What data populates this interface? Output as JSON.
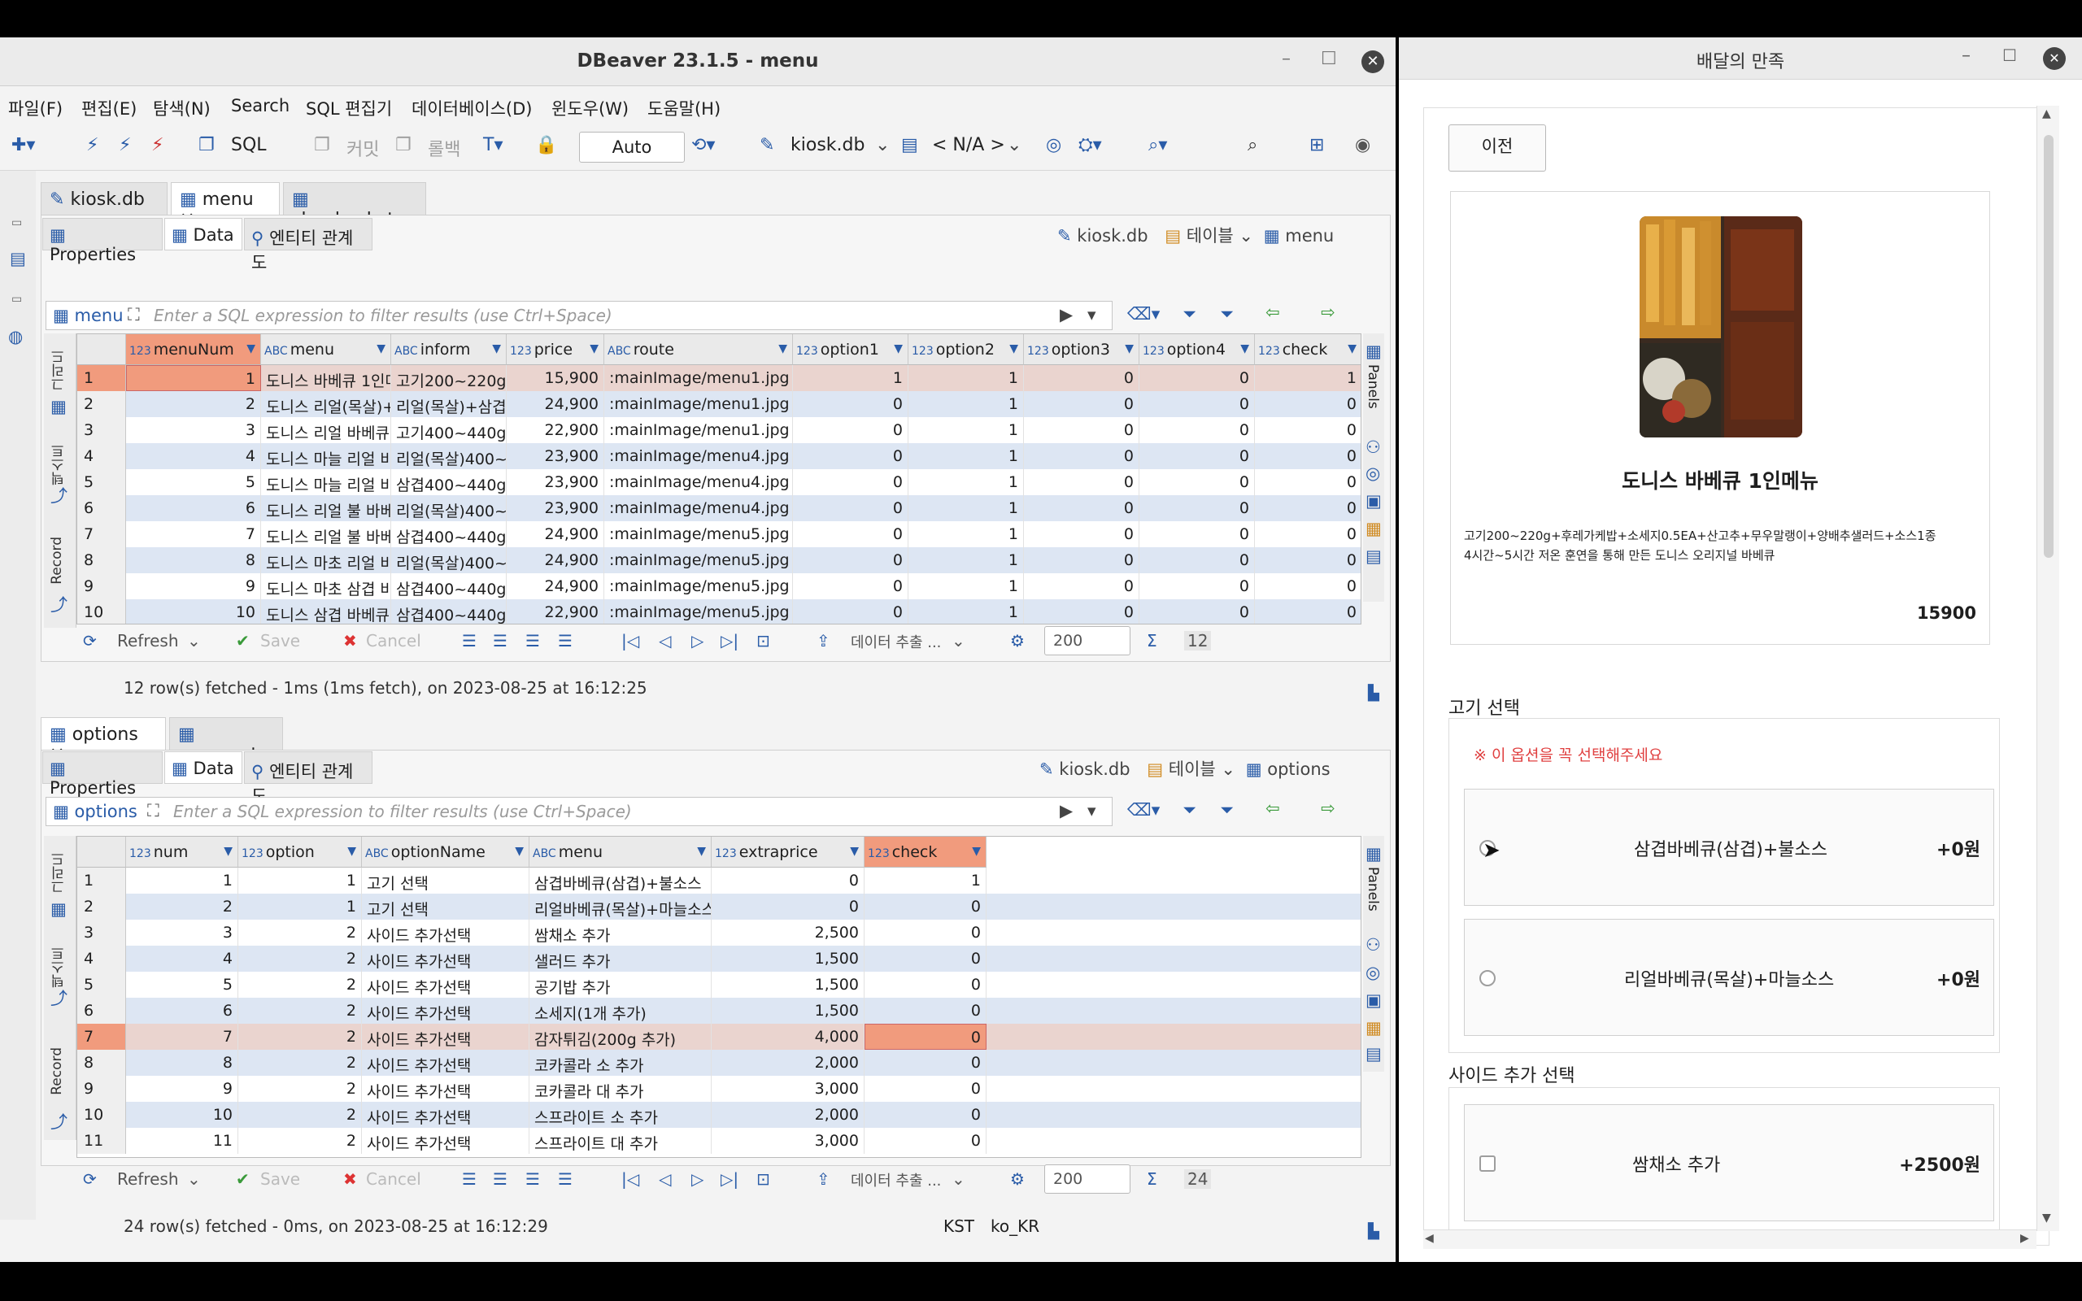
{
  "dbeaver": {
    "title": "DBeaver 23.1.5 - menu",
    "menu": [
      "파일(F)",
      "편집(E)",
      "탐색(N)",
      "Search",
      "SQL 편집기",
      "데이터베이스(D)",
      "윈도우(W)",
      "도움말(H)"
    ],
    "toolbar": {
      "sql_label": "SQL",
      "commit": "커밋",
      "rollback": "롤백",
      "auto": "Auto",
      "db": "kiosk.db",
      "schema": "< N/A >"
    },
    "editor_tabs_top": [
      "kiosk.db",
      "menu",
      "shopbaskets"
    ],
    "editor_tabs_bottom": [
      "options",
      "payment"
    ],
    "subtabs": [
      "Properties",
      "Data",
      "엔티티 관계도"
    ],
    "crumb_top": {
      "db": "kiosk.db",
      "kind": "테이블",
      "table": "menu"
    },
    "crumb_bottom": {
      "db": "kiosk.db",
      "kind": "테이블",
      "table": "options"
    },
    "filter_top": {
      "label": "menu",
      "placeholder": "Enter a SQL expression to filter results (use Ctrl+Space)"
    },
    "filter_bottom": {
      "label": "options",
      "placeholder": "Enter a SQL expression to filter results (use Ctrl+Space)"
    },
    "side_labels": [
      "그리드",
      "텍스트",
      "Record"
    ],
    "panels_label": "Panels",
    "grid_top": {
      "columns": [
        {
          "type": "123",
          "name": "menuNum"
        },
        {
          "type": "ABC",
          "name": "menu"
        },
        {
          "type": "ABC",
          "name": "inform"
        },
        {
          "type": "123",
          "name": "price"
        },
        {
          "type": "ABC",
          "name": "route"
        },
        {
          "type": "123",
          "name": "option1"
        },
        {
          "type": "123",
          "name": "option2"
        },
        {
          "type": "123",
          "name": "option3"
        },
        {
          "type": "123",
          "name": "option4"
        },
        {
          "type": "123",
          "name": "check"
        }
      ],
      "rows": [
        [
          "1",
          "1",
          "도니스 바베큐 1인메",
          "고기200~220g+",
          "15,900",
          ":mainImage/menu1.jpg",
          "1",
          "1",
          "0",
          "0",
          "1"
        ],
        [
          "2",
          "2",
          "도니스 리얼(목살)+싱",
          "리얼(목살)+삼겹4",
          "24,900",
          ":mainImage/menu1.jpg",
          "0",
          "1",
          "0",
          "0",
          "0"
        ],
        [
          "3",
          "3",
          "도니스 리얼 바베큐(",
          "고기400~440g+",
          "22,900",
          ":mainImage/menu1.jpg",
          "0",
          "1",
          "0",
          "0",
          "0"
        ],
        [
          "4",
          "4",
          "도니스 마늘 리얼 바",
          "리얼(목살)400~4",
          "23,900",
          ":mainImage/menu4.jpg",
          "0",
          "1",
          "0",
          "0",
          "0"
        ],
        [
          "5",
          "5",
          "도니스 마늘 리얼 바",
          "삼겹400~440g+",
          "23,900",
          ":mainImage/menu4.jpg",
          "0",
          "1",
          "0",
          "0",
          "0"
        ],
        [
          "6",
          "6",
          "도니스 리얼 불 바베",
          "리얼(목살)400~4",
          "23,900",
          ":mainImage/menu4.jpg",
          "0",
          "1",
          "0",
          "0",
          "0"
        ],
        [
          "7",
          "7",
          "도니스 리얼 불 바베",
          "삼겹400~440g+",
          "24,900",
          ":mainImage/menu5.jpg",
          "0",
          "1",
          "0",
          "0",
          "0"
        ],
        [
          "8",
          "8",
          "도니스 마초 리얼 바",
          "리얼(목살)400~4",
          "24,900",
          ":mainImage/menu5.jpg",
          "0",
          "1",
          "0",
          "0",
          "0"
        ],
        [
          "9",
          "9",
          "도니스 마초 삼겹 바",
          "삼겹400~440g+",
          "24,900",
          ":mainImage/menu5.jpg",
          "0",
          "1",
          "0",
          "0",
          "0"
        ],
        [
          "10",
          "10",
          "도니스 삼겹 바베큐(",
          "삼겹400~440g+",
          "22,900",
          ":mainImage/menu5.jpg",
          "0",
          "1",
          "0",
          "0",
          "0"
        ]
      ]
    },
    "grid_bottom": {
      "columns": [
        {
          "type": "123",
          "name": "num"
        },
        {
          "type": "123",
          "name": "option"
        },
        {
          "type": "ABC",
          "name": "optionName"
        },
        {
          "type": "ABC",
          "name": "menu"
        },
        {
          "type": "123",
          "name": "extraprice"
        },
        {
          "type": "123",
          "name": "check"
        }
      ],
      "rows": [
        [
          "1",
          "1",
          "1",
          "고기 선택",
          "삼겹바베큐(삼겹)+불소스",
          "0",
          "1"
        ],
        [
          "2",
          "2",
          "1",
          "고기 선택",
          "리얼바베큐(목살)+마늘소스",
          "0",
          "0"
        ],
        [
          "3",
          "3",
          "2",
          "사이드 추가선택",
          "쌈채소 추가",
          "2,500",
          "0"
        ],
        [
          "4",
          "4",
          "2",
          "사이드 추가선택",
          "샐러드 추가",
          "1,500",
          "0"
        ],
        [
          "5",
          "5",
          "2",
          "사이드 추가선택",
          "공기밥 추가",
          "1,500",
          "0"
        ],
        [
          "6",
          "6",
          "2",
          "사이드 추가선택",
          "소세지(1개 추가)",
          "1,500",
          "0"
        ],
        [
          "7",
          "7",
          "2",
          "사이드 추가선택",
          "감자튀김(200g 추가)",
          "4,000",
          "0"
        ],
        [
          "8",
          "8",
          "2",
          "사이드 추가선택",
          "코카콜라 소 추가",
          "2,000",
          "0"
        ],
        [
          "9",
          "9",
          "2",
          "사이드 추가선택",
          "코카콜라 대 추가",
          "3,000",
          "0"
        ],
        [
          "10",
          "10",
          "2",
          "사이드 추가선택",
          "스프라이트 소 추가",
          "2,000",
          "0"
        ],
        [
          "11",
          "11",
          "2",
          "사이드 추가선택",
          "스프라이트 대 추가",
          "3,000",
          "0"
        ]
      ]
    },
    "gridtool": {
      "refresh": "Refresh",
      "save": "Save",
      "cancel": "Cancel",
      "export": "데이터 추출 ...",
      "fetch_size": "200",
      "count_top": "12",
      "count_bottom": "24"
    },
    "status_top": "12 row(s) fetched - 1ms (1ms fetch), on 2023-08-25 at 16:12:25",
    "status_bottom": "24 row(s) fetched - 0ms, on 2023-08-25 at 16:12:29",
    "statusbar": {
      "tz": "KST",
      "locale": "ko_KR"
    }
  },
  "app": {
    "title": "배달의 만족",
    "back_button": "이전",
    "product": {
      "name": "도니스 바베큐 1인메뉴",
      "desc1": "고기200~220g+후레가케밥+소세지0.5EA+산고추+무우말랭이+양배추샐러드+소스1종",
      "desc2": "4시간~5시간 저온 훈연을 통해 만든 도니스 오리지널 바베큐",
      "price": "15900"
    },
    "meat_section": {
      "title": "고기 선택",
      "warning": "※ 이 옵션을 꼭 선택해주세요",
      "options": [
        {
          "label": "삼겹바베큐(삼겹)+불소스",
          "price": "+0원"
        },
        {
          "label": "리얼바베큐(목살)+마늘소스",
          "price": "+0원"
        }
      ]
    },
    "side_section": {
      "title": "사이드 추가 선택",
      "options": [
        {
          "label": "쌈채소 추가",
          "price": "+2500원"
        }
      ]
    }
  }
}
